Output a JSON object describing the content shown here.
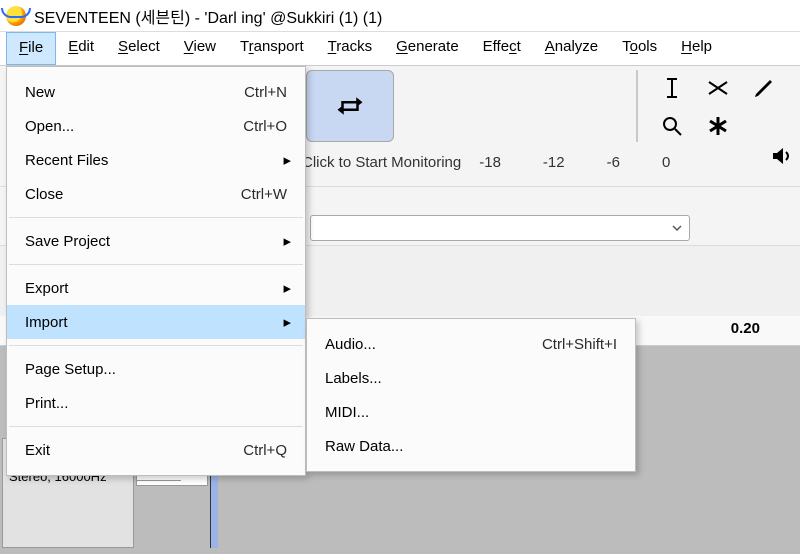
{
  "window_title": "SEVENTEEN (세븐틴) - 'Darl ing' @Sukkiri (1) (1)",
  "menubar": [
    "File",
    "Edit",
    "Select",
    "View",
    "Transport",
    "Tracks",
    "Generate",
    "Effect",
    "Analyze",
    "Tools",
    "Help"
  ],
  "file_menu": {
    "new": {
      "label": "New",
      "shortcut": "Ctrl+N"
    },
    "open": {
      "label": "Open...",
      "shortcut": "Ctrl+O"
    },
    "recent": {
      "label": "Recent Files"
    },
    "close": {
      "label": "Close",
      "shortcut": "Ctrl+W"
    },
    "save_project": {
      "label": "Save Project"
    },
    "export": {
      "label": "Export"
    },
    "import": {
      "label": "Import"
    },
    "page_setup": {
      "label": "Page Setup..."
    },
    "print": {
      "label": "Print..."
    },
    "exit": {
      "label": "Exit",
      "shortcut": "Ctrl+Q"
    }
  },
  "import_menu": {
    "audio": {
      "label": "Audio...",
      "shortcut": "Ctrl+Shift+I"
    },
    "labels": {
      "label": "Labels..."
    },
    "midi": {
      "label": "MIDI..."
    },
    "raw": {
      "label": "Raw Data..."
    }
  },
  "meter": {
    "label": "Click to Start Monitoring",
    "ticks": [
      "-18",
      "-12",
      "-6",
      "0"
    ]
  },
  "timeline_tick": "0.20",
  "track": {
    "gauge": "0.0",
    "format": "Stereo, 16000Hz"
  },
  "icons": {
    "play": "play-icon",
    "record": "record-icon",
    "loop": "loop-icon"
  }
}
